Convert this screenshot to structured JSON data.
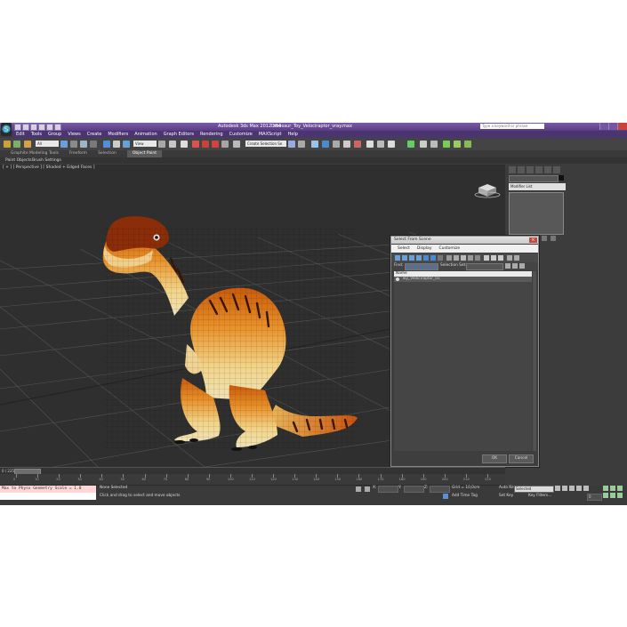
{
  "app": {
    "title_left": "Autodesk 3ds Max 2012 x64",
    "title_right": "Dinosaur_Toy_Velociraptor_vray.max",
    "search_placeholder": "Type a keyword or phrase"
  },
  "menu": [
    "Edit",
    "Tools",
    "Group",
    "Views",
    "Create",
    "Modifiers",
    "Animation",
    "Graph Editors",
    "Rendering",
    "Customize",
    "MAXScript",
    "Help"
  ],
  "toolbar": {
    "selection_filter": "All",
    "ref_coord": "View",
    "named_selection": "Create Selection Se"
  },
  "ribbon_tabs": [
    "Graphite Modeling Tools",
    "Freeform",
    "Selection",
    "Object Paint"
  ],
  "ribbon_active": "Object Paint",
  "subribbon": [
    "Paint Objects",
    "Brush Settings"
  ],
  "viewport": {
    "label": "[ + ] [ Perspective ] [ Shaded + Edged Faces ]"
  },
  "command_panel": {
    "modifier_list": "Modifier List"
  },
  "timeline": {
    "frame_label": "0 / 225",
    "ticks": [
      "0",
      "10",
      "20",
      "30",
      "40",
      "50",
      "60",
      "70",
      "80",
      "90",
      "100",
      "110",
      "120",
      "130",
      "140",
      "150",
      "160",
      "170",
      "180",
      "190",
      "200",
      "210",
      "220"
    ]
  },
  "status": {
    "maxscript_line1": "Max to Physx Geometry Scale = 1.0",
    "none_selected": "None Selected",
    "prompt": "Click and drag to select and move objects",
    "grid": "Grid = 10,0cm",
    "add_time_tag": "Add Time Tag",
    "auto_key": "Auto Key",
    "auto_key_value": "Selected",
    "set_key": "Set Key",
    "key_filters": "Key Filters...",
    "frame_value": "0"
  },
  "dialog": {
    "title": "Select From Scene",
    "menu": [
      "Select",
      "Display",
      "Customize"
    ],
    "find_label": "Find:",
    "selection_set_label": "Selection Set:",
    "column_name": "Name",
    "items": [
      "Toy_Velociraptor_01"
    ],
    "ok": "OK",
    "cancel": "Cancel"
  }
}
